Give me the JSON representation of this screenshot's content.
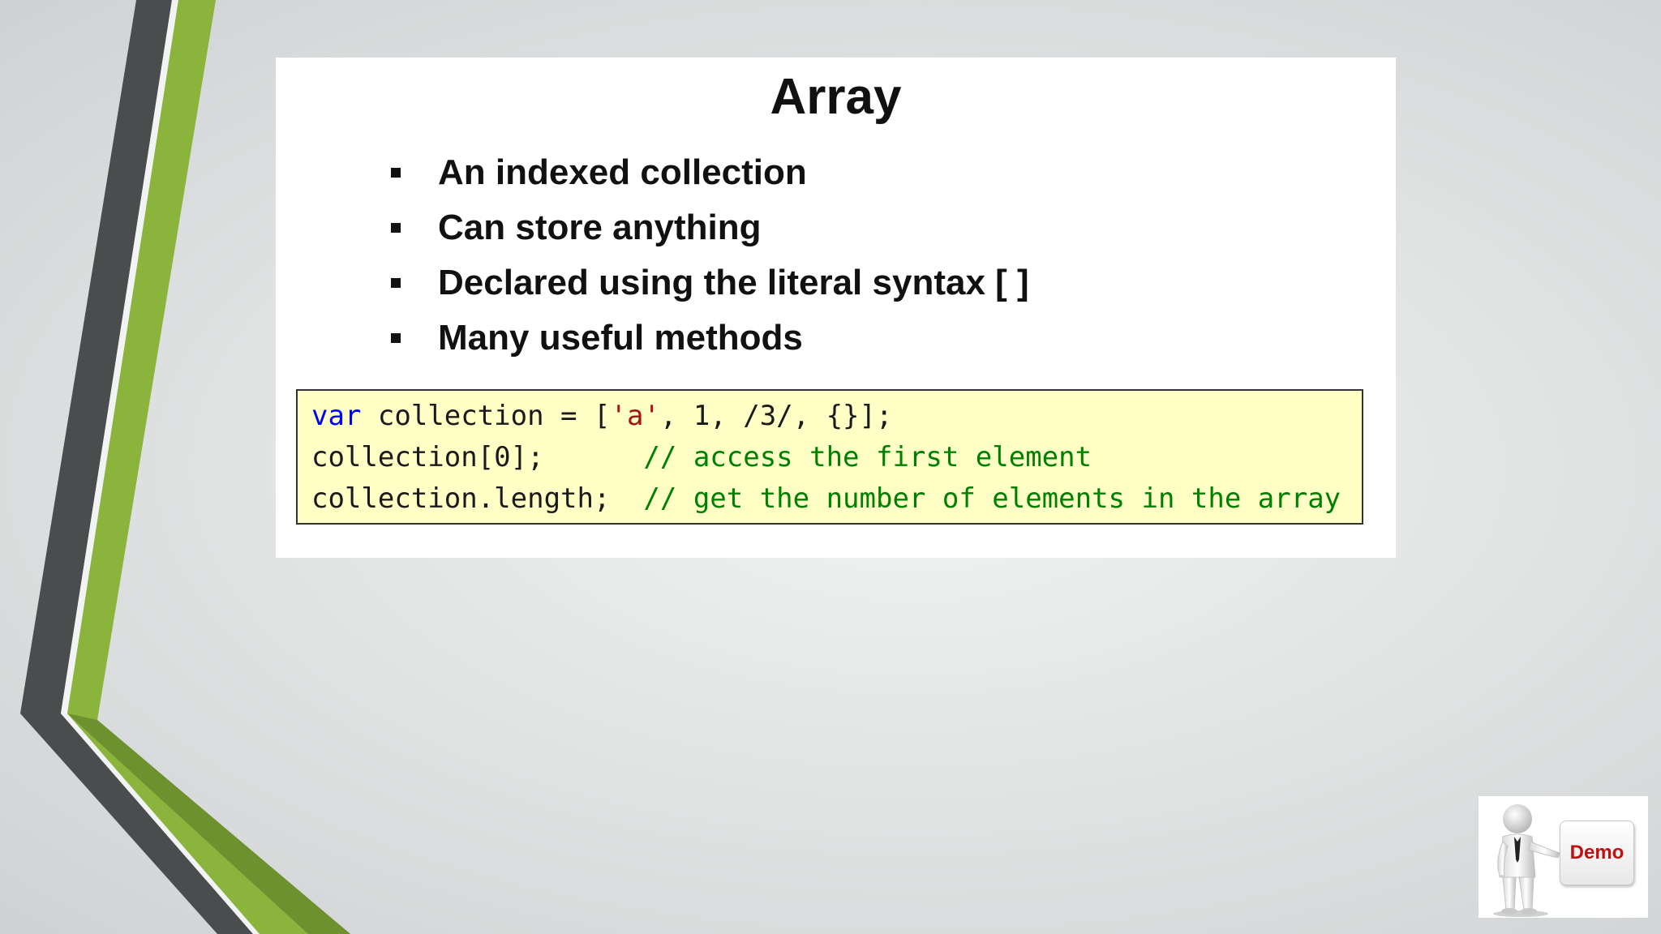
{
  "slide": {
    "title": "Array",
    "bullets": [
      "An indexed collection",
      "Can store anything",
      "Declared using the literal syntax [ ]",
      "Many useful methods"
    ],
    "code": {
      "line1": {
        "keyword": "var",
        "text_a": " collection = [",
        "string": "'a'",
        "text_b": ", 1, /3/, {}];"
      },
      "line2": {
        "code": "collection[0];      ",
        "comment": "// access the first element"
      },
      "line3": {
        "code": "collection.length;  ",
        "comment": "// get the number of elements in the array"
      }
    }
  },
  "badge": {
    "label": "Demo",
    "icon": "presenter-figure-icon"
  },
  "colors": {
    "accent_green": "#8bb43c",
    "accent_dark": "#4a4c4d",
    "code_background": "#ffffc6",
    "keyword": "#0000ff",
    "string": "#a31515",
    "comment": "#008000"
  }
}
